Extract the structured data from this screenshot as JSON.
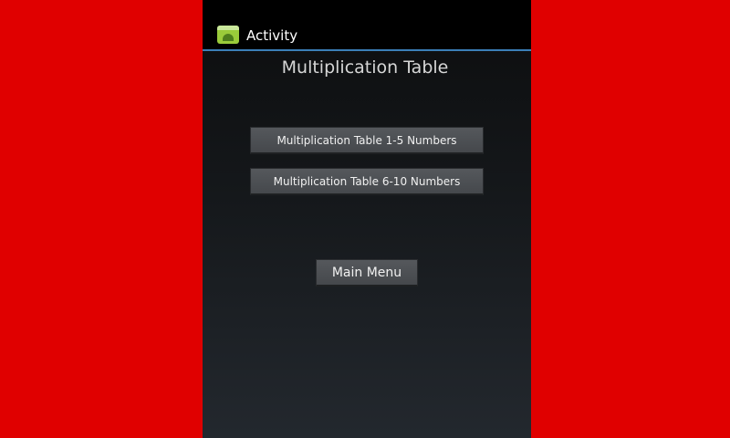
{
  "app_bar": {
    "title": "Activity",
    "icon": "android-app-icon"
  },
  "main": {
    "title": "Multiplication Table",
    "buttons": [
      {
        "label": "Multiplication Table 1-5 Numbers"
      },
      {
        "label": "Multiplication Table 6-10 Numbers"
      },
      {
        "label": "Main Menu"
      }
    ]
  },
  "colors": {
    "background": "#e00000",
    "action_bar": "#000000",
    "divider": "#3b7fb8",
    "title_text": "#d6d6d6",
    "button": "#4f5256"
  }
}
